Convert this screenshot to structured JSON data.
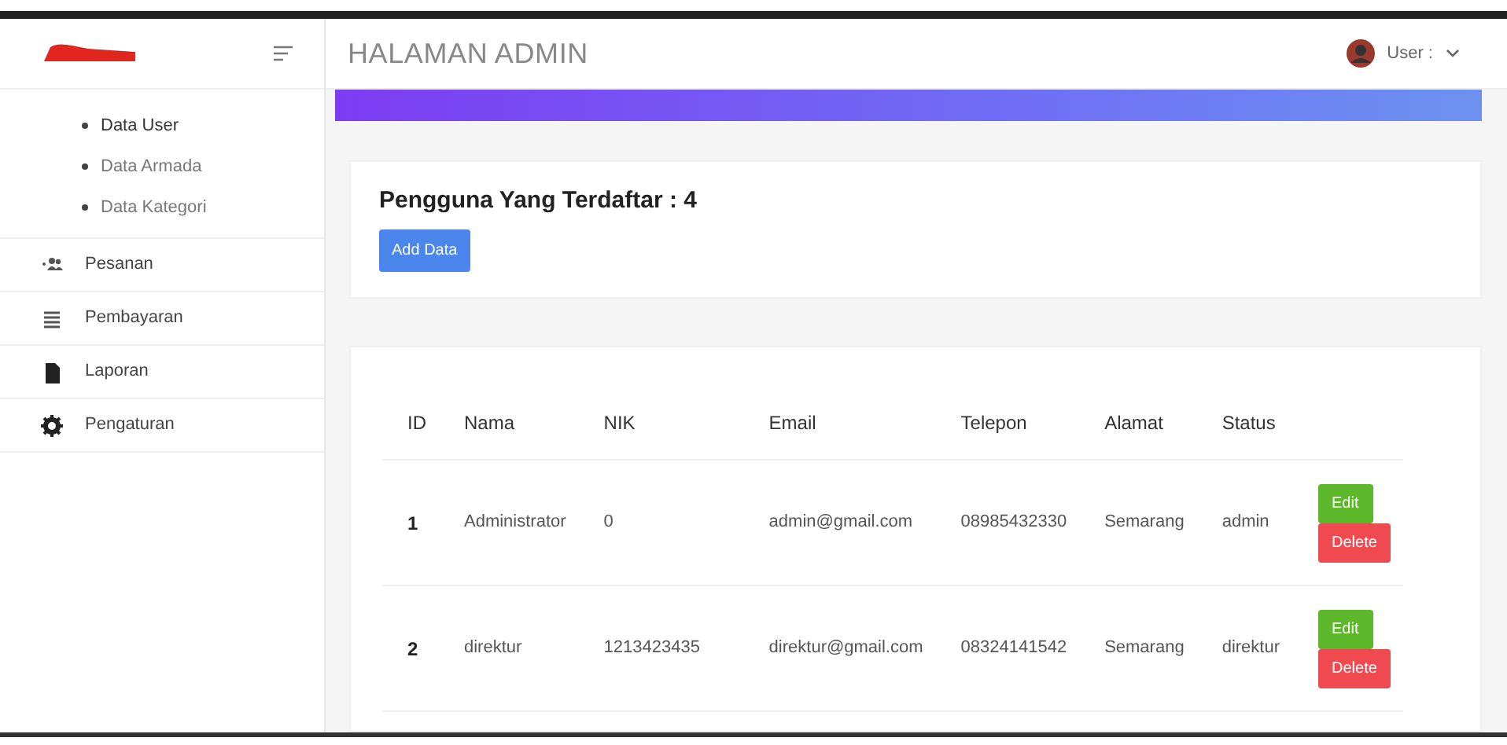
{
  "header": {
    "title": "HALAMAN ADMIN",
    "user_label": "User :"
  },
  "sidebar": {
    "subitems": [
      {
        "label": "Data User",
        "selected": true
      },
      {
        "label": "Data Armada",
        "selected": false
      },
      {
        "label": "Data Kategori",
        "selected": false
      }
    ],
    "items": [
      {
        "label": "Pesanan"
      },
      {
        "label": "Pembayaran"
      },
      {
        "label": "Laporan"
      },
      {
        "label": "Pengaturan"
      }
    ]
  },
  "summary": {
    "title": "Pengguna Yang Terdaftar : 4",
    "button": "Add Data"
  },
  "table": {
    "columns": [
      "ID",
      "Nama",
      "NIK",
      "Email",
      "Telepon",
      "Alamat",
      "Status"
    ],
    "rows": [
      {
        "cells": [
          "1",
          "Administrator",
          "0",
          "admin@gmail.com",
          "08985432330",
          "Semarang",
          "admin"
        ],
        "actions": [
          "Edit",
          "Delete"
        ]
      },
      {
        "cells": [
          "2",
          "direktur",
          "1213423435",
          "direktur@gmail.com",
          "08324141542",
          "Semarang",
          "direktur"
        ],
        "actions": [
          "Edit",
          "Delete"
        ]
      }
    ]
  }
}
